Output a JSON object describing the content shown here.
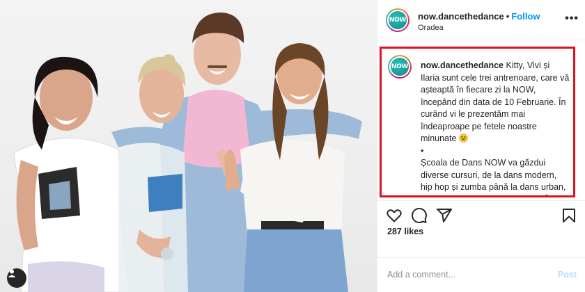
{
  "post": {
    "username": "now.dancethedance",
    "separator": "•",
    "follow_label": "Follow",
    "location": "Oradea",
    "more_label": "•••",
    "avatar_text": "NOW",
    "caption_username": "now.dancethedance",
    "caption_text_1": " Kitty, Vivi și Ilaria sunt cele trei antrenoare, care vă așteaptă în fiecare zi la NOW, începând din data de 10 Februarie. În curând vi le prezentăm mai îndeaproape pe fetele noastre minunate ",
    "caption_bullet": "•",
    "caption_text_2": "Școala de Dans NOW va găzdui diverse cursuri, de la dans modern, hip hop și zumba până la dans urban, K-pop, latino și cursuri de Yoga. În",
    "likes": "287 likes",
    "comment_placeholder": "Add a comment...",
    "post_label": "Post"
  },
  "icons": {
    "like": "heart-icon",
    "comment": "comment-icon",
    "share": "send-icon",
    "save": "bookmark-icon",
    "user_tag": "user-tag-icon",
    "emoji": "grinning-face-emoji"
  },
  "colors": {
    "follow": "#0095f6",
    "highlight_border": "#e0101f",
    "post_disabled": "#b3dbff",
    "text": "#262626",
    "muted": "#8e8e8e"
  }
}
